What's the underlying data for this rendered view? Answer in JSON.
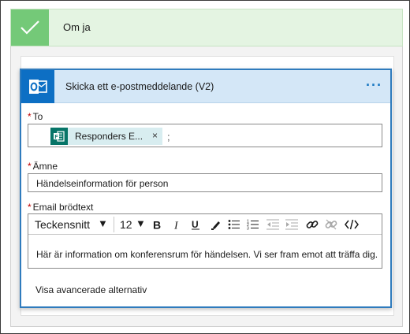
{
  "condition": {
    "title": "Om ja"
  },
  "card": {
    "title": "Skicka ett e-postmeddelande (V2)",
    "menu_glyph": "···"
  },
  "fields": {
    "to": {
      "required_mark": "*",
      "label": "To",
      "tokens": [
        {
          "label": "Responders E...",
          "close_glyph": "×"
        }
      ],
      "trailing": ";"
    },
    "subject": {
      "required_mark": "*",
      "label": "Ämne",
      "value": "Händelseinformation för person"
    },
    "body": {
      "required_mark": "*",
      "label": "Email brödtext",
      "toolbar": {
        "font": "Teckensnitt",
        "font_size": "12",
        "caret": "▼"
      },
      "text": "Här är information om konferensrum för händelsen. Vi ser fram emot att träffa dig."
    }
  },
  "advanced_link": "Visa avancerade alternativ",
  "colors": {
    "condition_bg": "#e4f4e2",
    "condition_icon": "#74c978",
    "card_border": "#2f7bbd",
    "card_header": "#d4e7f7",
    "outlook_blue": "#0d6fc4",
    "forms_green": "#077568",
    "token_bg": "#d8edf0",
    "required": "#c00000"
  },
  "icons": {
    "condition": "checkmark-icon",
    "connector": "outlook-icon",
    "token": "forms-icon",
    "toolbar": [
      "bold-icon",
      "italic-icon",
      "underline-icon",
      "color-pen-icon",
      "bullet-list-icon",
      "numbered-list-icon",
      "decrease-indent-icon",
      "increase-indent-icon",
      "link-icon",
      "unlink-icon",
      "code-view-icon"
    ]
  }
}
